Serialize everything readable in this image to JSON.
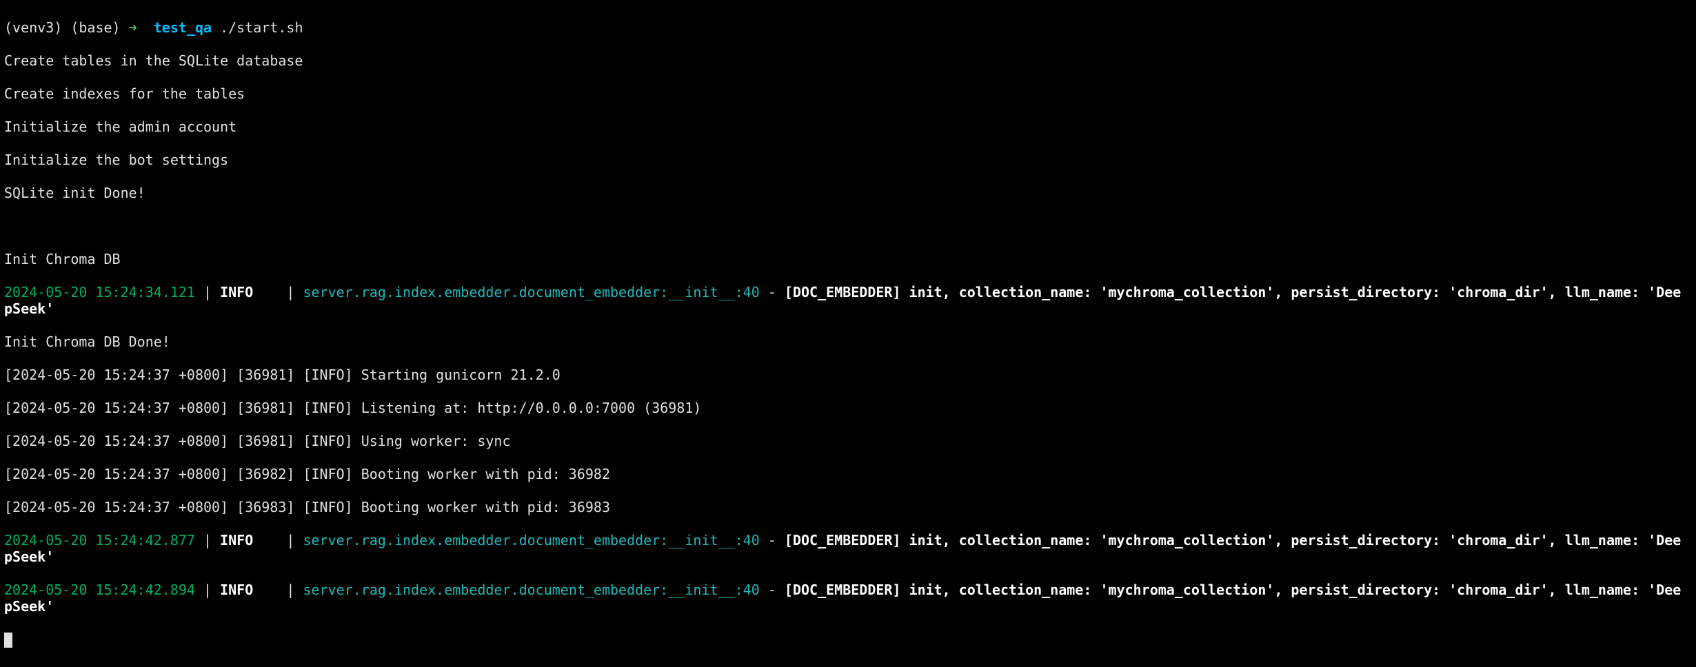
{
  "prompt": {
    "env": "(venv3) (base) ",
    "arrow": "➜  ",
    "dir": "test_qa",
    "cmd": " ./start.sh"
  },
  "startup_lines": [
    "Create tables in the SQLite database",
    "Create indexes for the tables",
    "Initialize the admin account",
    "Initialize the bot settings",
    "SQLite init Done!",
    "",
    "",
    "Init Chroma DB"
  ],
  "log": {
    "entries": [
      {
        "ts": "2024-05-20 15:24:34.121",
        "level": "INFO",
        "logger_name": "server.rag.index.embedder.document_embedder",
        "func": "__init__",
        "lineno": "40",
        "message": "[DOC_EMBEDDER] init, collection_name: 'mychroma_collection', persist_directory: 'chroma_dir', llm_name: 'DeepSeek'"
      }
    ],
    "after_first": [
      "Init Chroma DB Done!",
      "[2024-05-20 15:24:37 +0800] [36981] [INFO] Starting gunicorn 21.2.0",
      "[2024-05-20 15:24:37 +0800] [36981] [INFO] Listening at: http://0.0.0.0:7000 (36981)",
      "[2024-05-20 15:24:37 +0800] [36981] [INFO] Using worker: sync",
      "[2024-05-20 15:24:37 +0800] [36982] [INFO] Booting worker with pid: 36982",
      "[2024-05-20 15:24:37 +0800] [36983] [INFO] Booting worker with pid: 36983"
    ],
    "entries2": [
      {
        "ts": "2024-05-20 15:24:42.877",
        "level": "INFO",
        "logger_name": "server.rag.index.embedder.document_embedder",
        "func": "__init__",
        "lineno": "40",
        "message": "[DOC_EMBEDDER] init, collection_name: 'mychroma_collection', persist_directory: 'chroma_dir', llm_name: 'DeepSeek'"
      },
      {
        "ts": "2024-05-20 15:24:42.894",
        "level": "INFO",
        "logger_name": "server.rag.index.embedder.document_embedder",
        "func": "__init__",
        "lineno": "40",
        "message": "[DOC_EMBEDDER] init, collection_name: 'mychroma_collection', persist_directory: 'chroma_dir', llm_name: 'DeepSeek'"
      }
    ]
  },
  "sep": {
    "pipe": " | ",
    "pipe2": "    | ",
    "colon": ":",
    "dash": " - "
  }
}
